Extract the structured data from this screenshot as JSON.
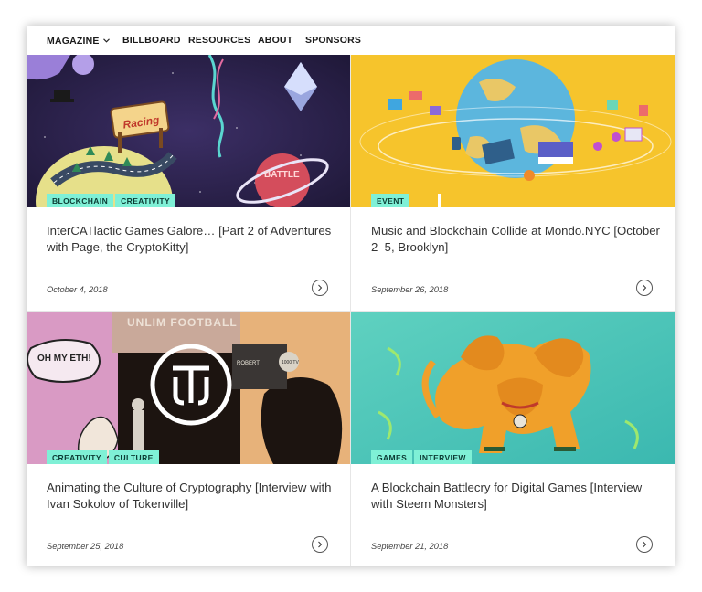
{
  "nav": {
    "items": [
      {
        "label": "MAGAZINE",
        "has_dropdown": true,
        "icon": "chevron-down-icon"
      },
      {
        "label": "BILLBOARD"
      },
      {
        "label": "RESOURCES"
      },
      {
        "label": "ABOUT"
      },
      {
        "label": "SPONSORS"
      }
    ]
  },
  "colors": {
    "tag_bg": "#7ff0d6",
    "tag_text": "#0b3a33",
    "title_text": "#333333"
  },
  "cards": [
    {
      "tags": [
        "BLOCKCHAIN",
        "CREATIVITY"
      ],
      "title": "InterCATlactic Games Galore… [Part 2 of Adventures with Page, the CryptoKitty]",
      "date": "October 4, 2018",
      "image": {
        "sign_text": "Racing",
        "planet_text": "BATTLE"
      }
    },
    {
      "tags": [
        "EVENT"
      ],
      "title": "Music and Blockchain Collide at Mondo.NYC [October 2–5, Brooklyn]",
      "date": "September 26, 2018"
    },
    {
      "tags": [
        "CREATIVITY",
        "CULTURE"
      ],
      "title": "Animating the Culture of Cryptography [Interview with Ivan Sokolov of Tokenville]",
      "date": "September 25, 2018",
      "image": {
        "bubble_text": "OH MY ETH!",
        "sign_text": "UNLIM FOOTBALL",
        "board_name": "ROBERT",
        "board_score": "1000 TV"
      }
    },
    {
      "tags": [
        "GAMES",
        "INTERVIEW"
      ],
      "title": "A Blockchain Battlecry for Digital Games [Interview with Steem Monsters]",
      "date": "September 21, 2018"
    }
  ]
}
